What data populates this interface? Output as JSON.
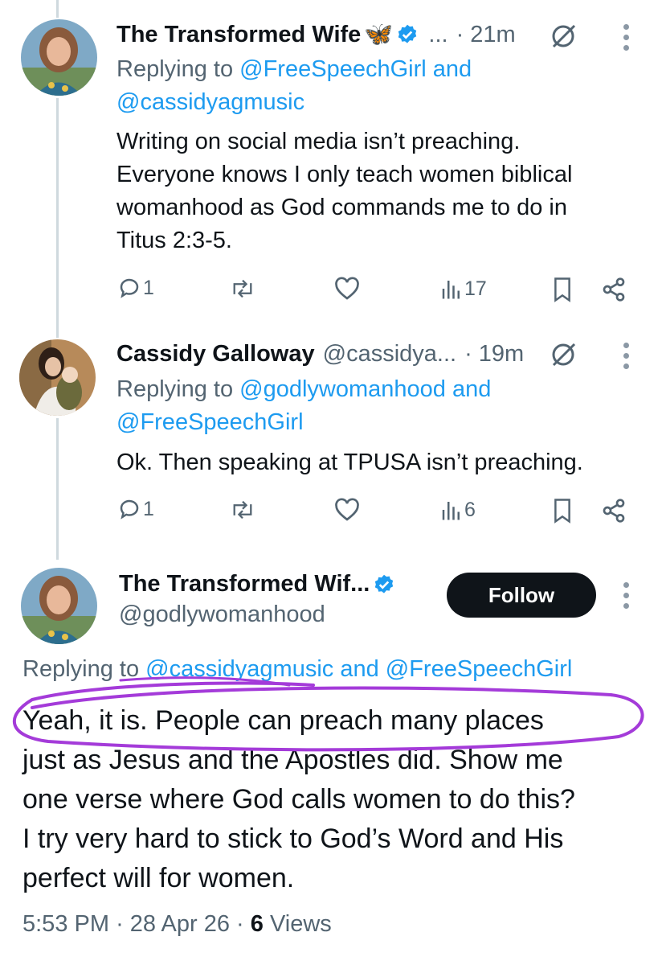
{
  "tweets": [
    {
      "name": "The Transformed Wife",
      "name_emoji": "🦋",
      "handle_trunc": "...",
      "time": "· 21m",
      "replying_prefix": "Replying to ",
      "replying_to_1": "@FreeSpeechGirl",
      "replying_and": " and",
      "replying_to_2": "@cassidyagmusic",
      "lines": [
        "Writing on social media isn’t preaching.",
        "Everyone knows I only teach women biblical",
        "womanhood as God commands me to do in",
        "Titus 2:3-5."
      ],
      "replies": "1",
      "views": "17"
    },
    {
      "name": "Cassidy Galloway",
      "handle": "@cassidya...",
      "time": "· 19m",
      "replying_prefix": "Replying to ",
      "replying_to_1": "@godlywomanhood",
      "replying_and": " and",
      "replying_to_2": "@FreeSpeechGirl",
      "lines": [
        "Ok. Then speaking at TPUSA isn’t preaching."
      ],
      "replies": "1",
      "views": "6"
    }
  ],
  "main": {
    "name": "The Transformed Wif...",
    "handle": "@godlywomanhood",
    "follow_label": "Follow",
    "replying_prefix": "Replying to ",
    "replying_to_1": "@cassidyagmusic",
    "replying_and": " and ",
    "replying_to_2": "@FreeSpeechGirl",
    "lines": [
      "Yeah, it is. People can preach many places",
      "just as Jesus and the Apostles did. Show me",
      "one verse where God calls women to do this?",
      "I try very hard to stick to God’s Word and His",
      "perfect will for women."
    ],
    "time": "5:53 PM",
    "date": "28 Apr 26",
    "views_count": "6",
    "views_label": "Views",
    "sep": "·"
  },
  "colors": {
    "link": "#1d9bf0",
    "muted": "#536471",
    "verified": "#1d9bf0",
    "annotation": "#a43bd9"
  },
  "icons": [
    "reply-icon",
    "retweet-icon",
    "like-icon",
    "views-icon",
    "bookmark-icon",
    "share-icon",
    "grok-icon",
    "more-icon",
    "verified-icon"
  ]
}
